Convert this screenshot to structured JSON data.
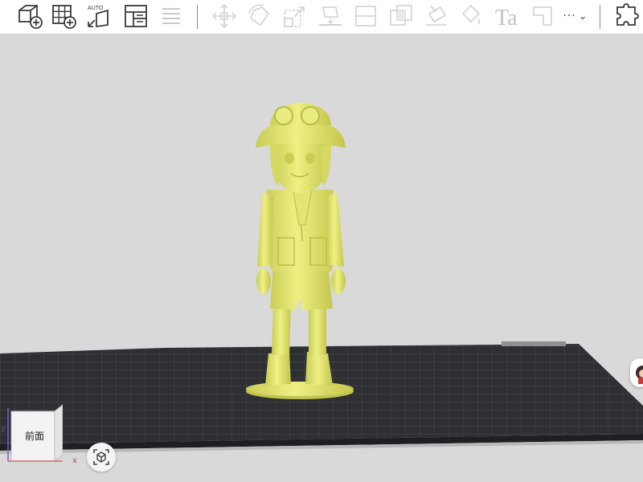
{
  "toolbar": {
    "groups": [
      {
        "name": "primary",
        "items": [
          "add-object",
          "add-grid-object",
          "auto-arrange",
          "layout",
          "list"
        ]
      },
      {
        "name": "edit",
        "items": [
          "move",
          "rotate",
          "scale",
          "place-on-face",
          "split",
          "boolean",
          "paint",
          "fill",
          "text",
          "cut"
        ]
      },
      {
        "name": "right",
        "items": [
          "more",
          "puzzle-plugin"
        ]
      }
    ],
    "auto_label": "AUTO",
    "text_tool_label": "Ta",
    "more_label": "···",
    "more_caret": "⌄"
  },
  "viewport": {
    "background": "#d9d9d9",
    "model_color": "#e6e97a",
    "bed_color": "#2f3033",
    "grid_line_color": "#5a5c60"
  },
  "view_cube": {
    "face_label": "前面",
    "axis_x": "x",
    "axis_z": "z"
  },
  "colors": {
    "icon": "#3a3a3a",
    "icon_disabled": "#b5b5b5",
    "separator": "#8a8a8a"
  }
}
